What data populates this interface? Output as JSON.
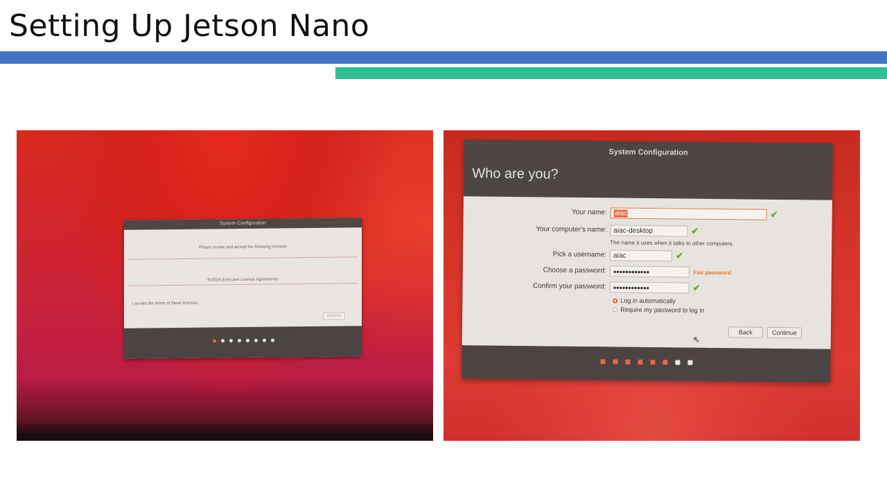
{
  "slide": {
    "title": "Setting Up Jetson Nano"
  },
  "left_dialog": {
    "header": "System Configuration",
    "review_text": "Please review and accept the following licenses",
    "license_name": "NVIDIA End User License Agreements",
    "accept_label": "I accept the terms of these licenses",
    "continue_label": "Continue",
    "progress": {
      "current": 1,
      "total": 8
    }
  },
  "right_dialog": {
    "header": "System Configuration",
    "heading": "Who are you?",
    "fields": {
      "name_label": "Your name:",
      "name_value": "aiac",
      "computer_label": "Your computer's name:",
      "computer_value": "aiac-desktop",
      "computer_hint": "The name it uses when it talks to other computers.",
      "username_label": "Pick a username:",
      "username_value": "aiac",
      "password_label": "Choose a password:",
      "password_value": "●●●●●●●●●●●●",
      "password_strength": "Fair password",
      "confirm_label": "Confirm your password:",
      "confirm_value": "●●●●●●●●●●●●"
    },
    "login_auto": "Log in automatically",
    "login_require": "Require my password to log in",
    "back_label": "Back",
    "continue_label": "Continue",
    "progress": {
      "current": 6,
      "total": 8
    }
  },
  "colors": {
    "blue_bar": "#4472C4",
    "green_bar": "#2EC092",
    "accent_orange": "#e9683f",
    "check_green": "#6aa82a"
  }
}
